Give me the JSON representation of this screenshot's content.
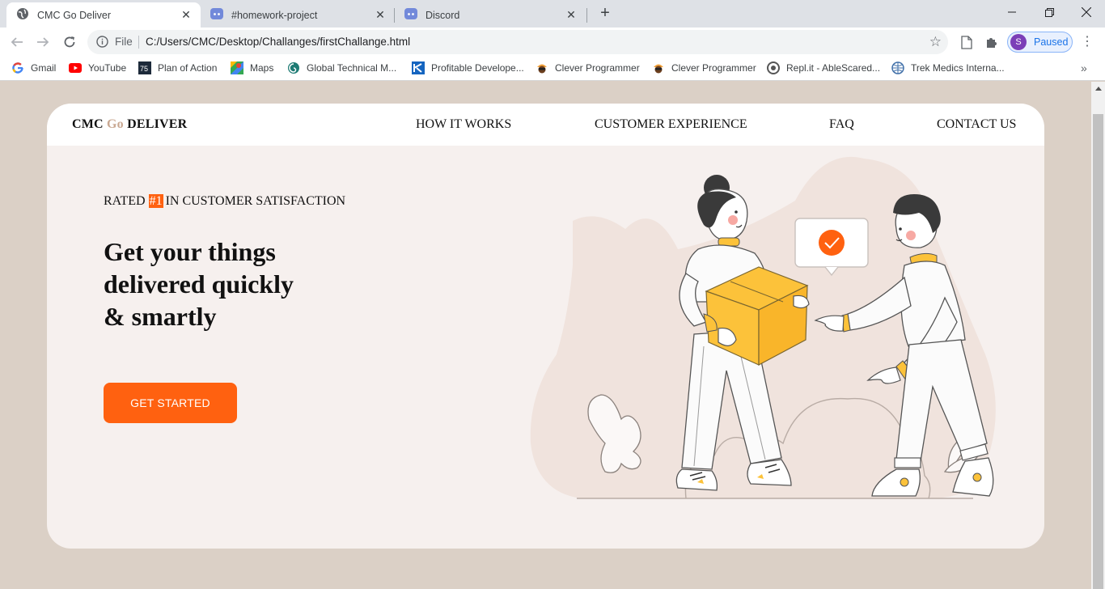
{
  "browser": {
    "tabs": [
      {
        "title": "CMC Go Deliver",
        "active": true,
        "icon": "globe-icon"
      },
      {
        "title": "#homework-project",
        "active": false,
        "icon": "discord-icon"
      },
      {
        "title": "Discord",
        "active": false,
        "icon": "discord-icon"
      }
    ],
    "omnibox": {
      "scheme_label": "File",
      "url": "C:/Users/CMC/Desktop/Challanges/firstChallange.html"
    },
    "profile": {
      "initial": "S",
      "status": "Paused"
    },
    "bookmarks": [
      {
        "label": "Gmail",
        "icon": "google-icon"
      },
      {
        "label": "YouTube",
        "icon": "youtube-icon"
      },
      {
        "label": "Plan of Action",
        "icon": "plan-icon"
      },
      {
        "label": "Maps",
        "icon": "maps-icon"
      },
      {
        "label": "Global Technical M...",
        "icon": "global-icon"
      },
      {
        "label": "Profitable Develope...",
        "icon": "profitable-icon"
      },
      {
        "label": "Clever Programmer",
        "icon": "clever-icon"
      },
      {
        "label": "Clever Programmer",
        "icon": "clever-icon"
      },
      {
        "label": "Repl.it - AbleScared...",
        "icon": "replit-icon"
      },
      {
        "label": "Trek Medics Interna...",
        "icon": "trek-icon"
      }
    ]
  },
  "page": {
    "logo": {
      "part1": "CMC",
      "part2": "Go",
      "part3": "DELIVER"
    },
    "nav": [
      "HOW IT WORKS",
      "CUSTOMER EXPERIENCE",
      "FAQ",
      "CONTACT US"
    ],
    "hero": {
      "rated_prefix": "RATED",
      "rated_badge": "#1",
      "rated_suffix": "IN CUSTOMER SATISFACTION",
      "headline": [
        "Get your things",
        "delivered quickly",
        "& smartly"
      ],
      "cta": "GET STARTED"
    },
    "colors": {
      "accent": "#ff6110",
      "background": "#dbd0c6",
      "card": "#f6f0ee",
      "box_yellow": "#fcc23a"
    }
  }
}
